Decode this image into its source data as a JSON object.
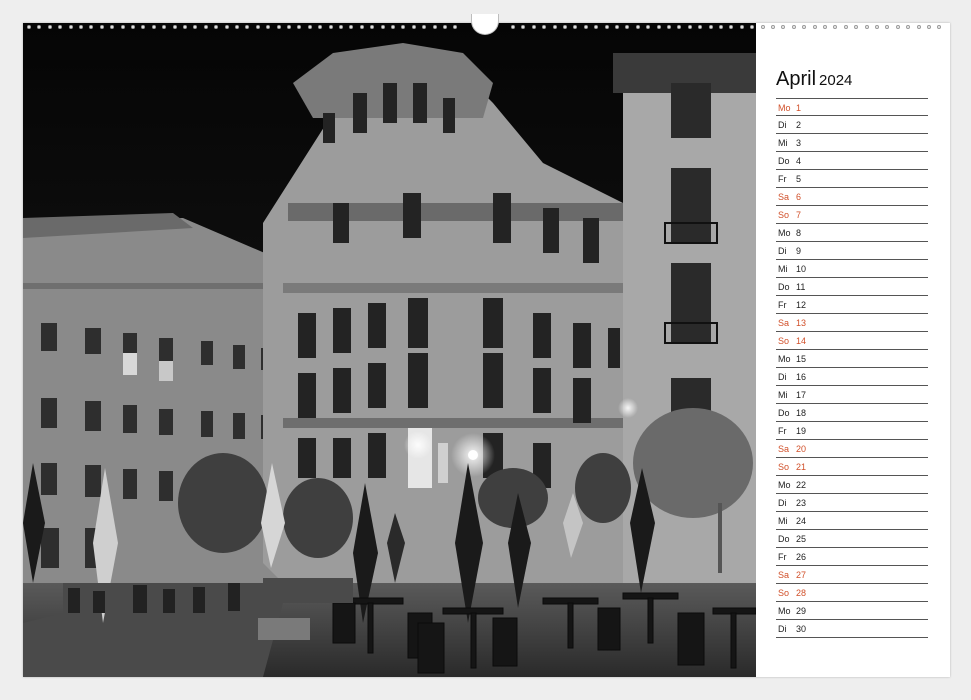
{
  "calendar": {
    "month": "April",
    "year": "2024",
    "accent_color": "#d1502a",
    "days": [
      {
        "wd": "Mo",
        "d": "1",
        "weekend": true
      },
      {
        "wd": "Di",
        "d": "2",
        "weekend": false
      },
      {
        "wd": "Mi",
        "d": "3",
        "weekend": false
      },
      {
        "wd": "Do",
        "d": "4",
        "weekend": false
      },
      {
        "wd": "Fr",
        "d": "5",
        "weekend": false
      },
      {
        "wd": "Sa",
        "d": "6",
        "weekend": true
      },
      {
        "wd": "So",
        "d": "7",
        "weekend": true
      },
      {
        "wd": "Mo",
        "d": "8",
        "weekend": false
      },
      {
        "wd": "Di",
        "d": "9",
        "weekend": false
      },
      {
        "wd": "Mi",
        "d": "10",
        "weekend": false
      },
      {
        "wd": "Do",
        "d": "11",
        "weekend": false
      },
      {
        "wd": "Fr",
        "d": "12",
        "weekend": false
      },
      {
        "wd": "Sa",
        "d": "13",
        "weekend": true
      },
      {
        "wd": "So",
        "d": "14",
        "weekend": true
      },
      {
        "wd": "Mo",
        "d": "15",
        "weekend": false
      },
      {
        "wd": "Di",
        "d": "16",
        "weekend": false
      },
      {
        "wd": "Mi",
        "d": "17",
        "weekend": false
      },
      {
        "wd": "Do",
        "d": "18",
        "weekend": false
      },
      {
        "wd": "Fr",
        "d": "19",
        "weekend": false
      },
      {
        "wd": "Sa",
        "d": "20",
        "weekend": true
      },
      {
        "wd": "So",
        "d": "21",
        "weekend": true
      },
      {
        "wd": "Mo",
        "d": "22",
        "weekend": false
      },
      {
        "wd": "Di",
        "d": "23",
        "weekend": false
      },
      {
        "wd": "Mi",
        "d": "24",
        "weekend": false
      },
      {
        "wd": "Do",
        "d": "25",
        "weekend": false
      },
      {
        "wd": "Fr",
        "d": "26",
        "weekend": false
      },
      {
        "wd": "Sa",
        "d": "27",
        "weekend": true
      },
      {
        "wd": "So",
        "d": "28",
        "weekend": true
      },
      {
        "wd": "Mo",
        "d": "29",
        "weekend": false
      },
      {
        "wd": "Di",
        "d": "30",
        "weekend": false
      }
    ]
  },
  "photo": {
    "icon": "black-and-white-night-plaza-photo"
  }
}
